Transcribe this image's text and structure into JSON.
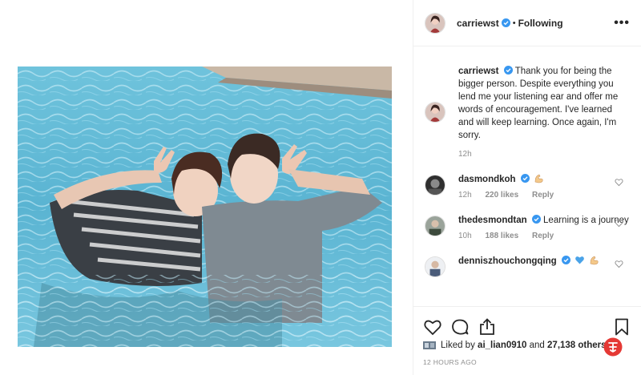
{
  "post": {
    "author": "carriewst",
    "separator": "•",
    "follow_status": "Following",
    "more": "•••"
  },
  "comments": [
    {
      "username": "carriewst",
      "text": "Thank you for being the bigger person. Despite everything you lend me your listening ear and offer me words of encouragement. I've learned and will keep learning. Once again, I'm sorry.",
      "time": "12h"
    },
    {
      "username": "dasmondkoh",
      "emoji": "flexed-biceps",
      "time": "12h",
      "likes": "220 likes",
      "reply": "Reply"
    },
    {
      "username": "thedesmondtan",
      "text": "Learning is a journey",
      "time": "10h",
      "likes": "188 likes",
      "reply": "Reply"
    },
    {
      "username": "dennisz hou chongqing",
      "display": "dennis zhouchongqing",
      "emoji": "blue-heart-and-biceps"
    }
  ],
  "likes": {
    "prefix": "Liked by ",
    "user": "ai_lian0910",
    "middle": " and ",
    "count": "27,138 others"
  },
  "time_ago": "12 HOURS AGO",
  "colors": {
    "verified": "#3897f0",
    "muted": "#8e8e8e",
    "text": "#262626",
    "pool": "#5fb8d6",
    "watermark": "#e53935"
  }
}
